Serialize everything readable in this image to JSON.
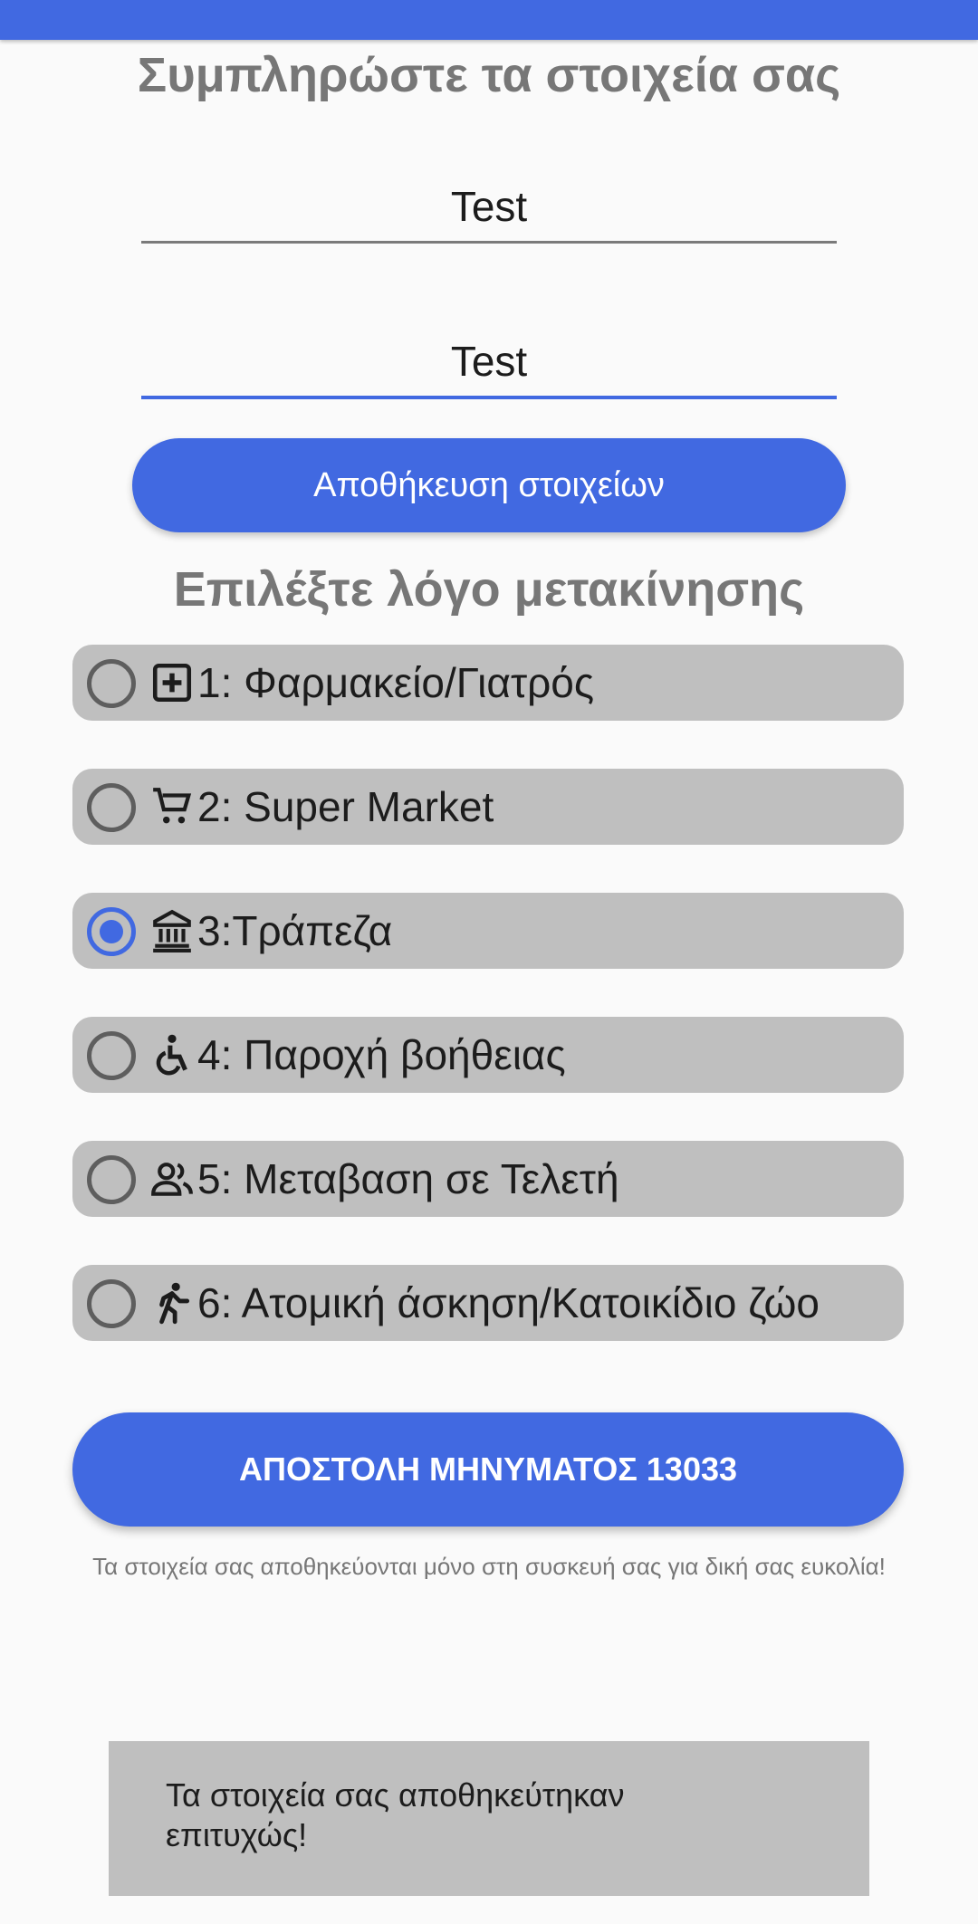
{
  "colors": {
    "accent": "#4169e1",
    "option_background": "#bfbfbf",
    "heading_text": "#777777",
    "page_background": "#fafafa"
  },
  "page_title": "Συμπληρώστε τα στοιχεία σας",
  "form": {
    "field_1_value": "Test",
    "field_2_value": "Test",
    "save_label": "Αποθήκευση στοιχείων"
  },
  "reason_title": "Επιλέξτε λόγο μετακίνησης",
  "options": [
    {
      "label": "1: Φαρμακείο/Γιατρός",
      "icon": "medical-plus-icon",
      "selected": false
    },
    {
      "label": "2: Super Market",
      "icon": "shopping-cart-icon",
      "selected": false
    },
    {
      "label": "3:Τράπεζα",
      "icon": "bank-icon",
      "selected": true
    },
    {
      "label": "4: Παροχή βοήθειας",
      "icon": "accessibility-icon",
      "selected": false
    },
    {
      "label": "5: Μεταβαση σε Τελετή",
      "icon": "people-icon",
      "selected": false
    },
    {
      "label": "6: Ατομική άσκηση/Κατοικίδιο ζώο",
      "icon": "running-icon",
      "selected": false
    }
  ],
  "send_label": "ΑΠΟΣΤΟΛΗ ΜΗΝΥΜΑΤΟΣ 13033",
  "note": "Τα στοιχεία σας αποθηκεύονται μόνο στη συσκευή σας για δική σας ευκολία!",
  "toast": "Τα στοιχεία σας αποθηκεύτηκαν επιτυχώς!"
}
